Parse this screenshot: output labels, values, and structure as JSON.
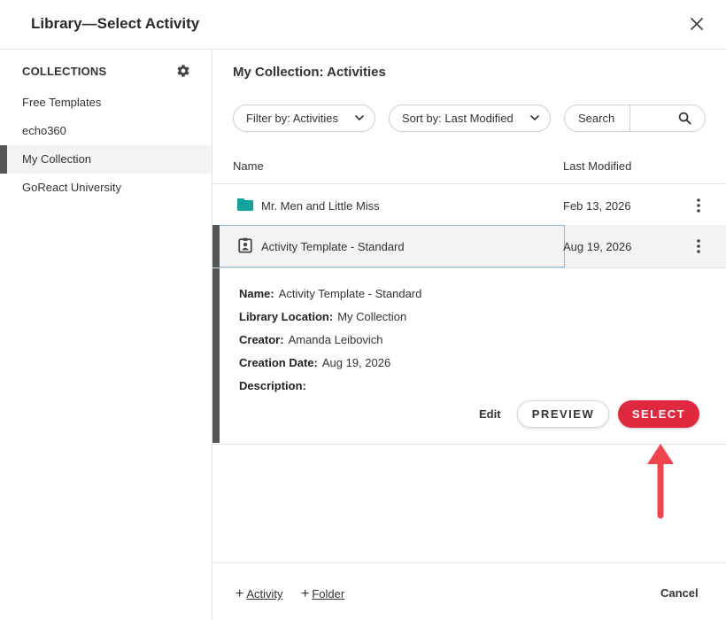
{
  "dialog": {
    "title": "Library—Select Activity"
  },
  "sidebar": {
    "section_title": "COLLECTIONS",
    "items": [
      {
        "label": "Free Templates"
      },
      {
        "label": "echo360"
      },
      {
        "label": "My Collection",
        "active": true
      },
      {
        "label": "GoReact University"
      }
    ]
  },
  "main": {
    "heading": "My Collection: Activities",
    "filter_label": "Filter by: Activities",
    "sort_label": "Sort by: Last Modified",
    "search_label": "Search",
    "search_value": "",
    "columns": {
      "name": "Name",
      "modified": "Last Modified"
    },
    "rows": [
      {
        "type": "folder",
        "name": "Mr. Men and Little Miss",
        "date": "Feb 13, 2026"
      },
      {
        "type": "activity",
        "name": "Activity Template - Standard",
        "date": "Aug 19, 2026"
      }
    ],
    "detail": {
      "name_label": "Name:",
      "name_value": "Activity Template - Standard",
      "location_label": "Library Location:",
      "location_value": "My Collection",
      "creator_label": "Creator:",
      "creator_value": "Amanda Leibovich",
      "date_label": "Creation Date:",
      "date_value": "Aug 19, 2026",
      "description_label": "Description:",
      "description_value": "",
      "edit_label": "Edit",
      "preview_label": "PREVIEW",
      "select_label": "SELECT"
    }
  },
  "footer": {
    "add_activity": "Activity",
    "add_folder": "Folder",
    "cancel": "Cancel"
  },
  "colors": {
    "accent": "#e0283e",
    "folder": "#14a39a",
    "arrow": "#f0454e"
  },
  "icons": [
    "close-icon",
    "gear-icon",
    "chevron-down-icon",
    "search-icon",
    "folder-icon",
    "clipboard-icon",
    "kebab-icon",
    "plus-icon"
  ]
}
